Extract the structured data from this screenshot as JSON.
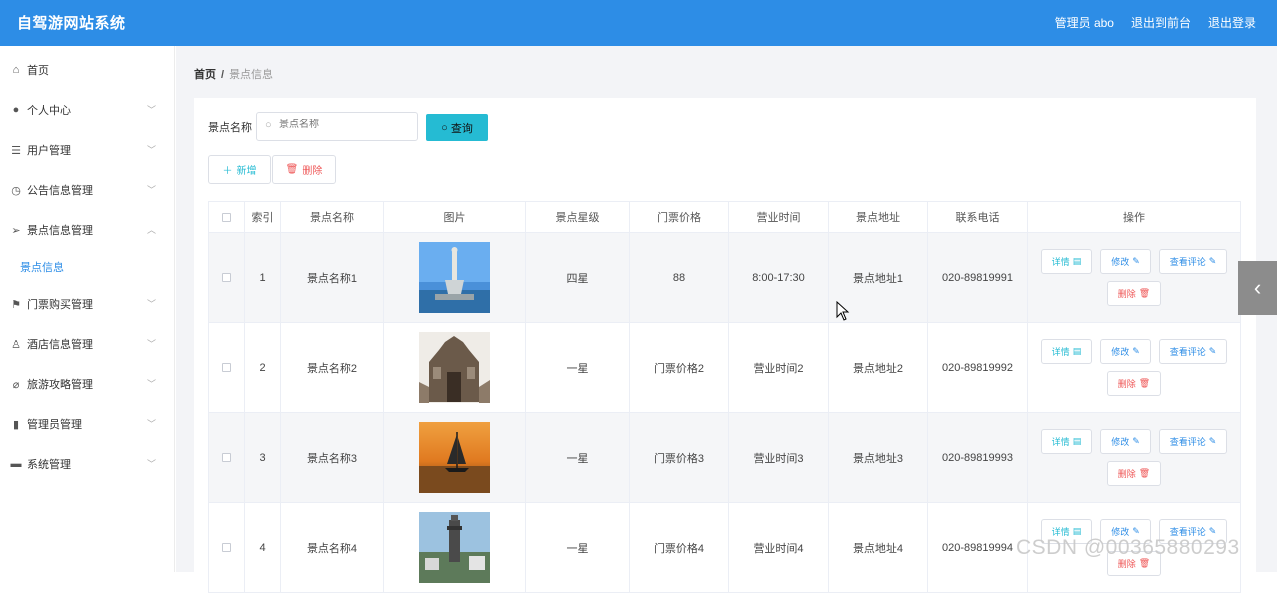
{
  "header": {
    "app_title": "自驾游网站系统",
    "admin": "管理员 abo",
    "to_front": "退出到前台",
    "logout": "退出登录"
  },
  "sidebar": {
    "items": [
      {
        "label": "首页",
        "icon": "home-icon",
        "has_chevron": false
      },
      {
        "label": "个人中心",
        "icon": "user-icon",
        "has_chevron": true
      },
      {
        "label": "用户管理",
        "icon": "list-icon",
        "has_chevron": true
      },
      {
        "label": "公告信息管理",
        "icon": "clock-icon",
        "has_chevron": true
      },
      {
        "label": "景点信息管理",
        "icon": "send-icon",
        "has_chevron": true,
        "expanded": true
      },
      {
        "label": "门票购买管理",
        "icon": "flag-icon",
        "has_chevron": true
      },
      {
        "label": "酒店信息管理",
        "icon": "person-icon",
        "has_chevron": true
      },
      {
        "label": "旅游攻略管理",
        "icon": "bell-off-icon",
        "has_chevron": true
      },
      {
        "label": "管理员管理",
        "icon": "bar-chart-icon",
        "has_chevron": true
      },
      {
        "label": "系统管理",
        "icon": "comment-icon",
        "has_chevron": true
      }
    ],
    "submenu_active": "景点信息"
  },
  "breadcrumb": {
    "home": "首页",
    "separator": "/",
    "current": "景点信息"
  },
  "search": {
    "label": "景点名称",
    "placeholder": "景点名称",
    "query_label": "查询"
  },
  "actions": {
    "add_label": "新增",
    "delete_label": "删除"
  },
  "table": {
    "headers": [
      "索引",
      "景点名称",
      "图片",
      "景点星级",
      "门票价格",
      "营业时间",
      "景点地址",
      "联系电话",
      "操作"
    ],
    "rows": [
      {
        "index": "1",
        "name": "景点名称1",
        "image": "statue-on-sea",
        "star": "四星",
        "price": "88",
        "hours": "8:00-17:30",
        "address": "景点地址1",
        "phone": "020-89819991"
      },
      {
        "index": "2",
        "name": "景点名称2",
        "image": "old-building",
        "star": "一星",
        "price": "门票价格2",
        "hours": "营业时间2",
        "address": "景点地址2",
        "phone": "020-89819992"
      },
      {
        "index": "3",
        "name": "景点名称3",
        "image": "sailboat-sunset",
        "star": "一星",
        "price": "门票价格3",
        "hours": "营业时间3",
        "address": "景点地址3",
        "phone": "020-89819993"
      },
      {
        "index": "4",
        "name": "景点名称4",
        "image": "city-tower",
        "star": "一星",
        "price": "门票价格4",
        "hours": "营业时间4",
        "address": "景点地址4",
        "phone": "020-89819994"
      }
    ],
    "row_actions": {
      "detail": "详情",
      "edit": "修改",
      "comment": "查看评论",
      "delete": "删除"
    }
  },
  "watermark": "CSDN @00365880293",
  "colors": {
    "header_bg": "#2d8de6",
    "accent_cyan": "#25bbd3",
    "danger": "#e55"
  }
}
